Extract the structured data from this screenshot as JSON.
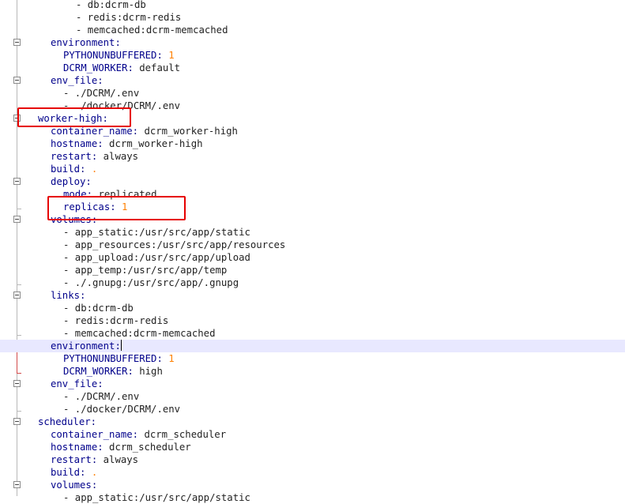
{
  "editor": {
    "current_line_index": 27,
    "lines": [
      {
        "indent": 6,
        "parts": [
          {
            "t": "- db:dcrm-db",
            "c": "str"
          }
        ]
      },
      {
        "indent": 6,
        "parts": [
          {
            "t": "- redis:dcrm-redis",
            "c": "str"
          }
        ]
      },
      {
        "indent": 6,
        "parts": [
          {
            "t": "- memcached:dcrm-memcached",
            "c": "str"
          }
        ]
      },
      {
        "indent": 2,
        "parts": [
          {
            "t": "environment",
            "c": "key"
          },
          {
            "t": ":",
            "c": "punc"
          }
        ]
      },
      {
        "indent": 4,
        "parts": [
          {
            "t": "PYTHONUNBUFFERED",
            "c": "key"
          },
          {
            "t": ": ",
            "c": "punc"
          },
          {
            "t": "1",
            "c": "num"
          }
        ]
      },
      {
        "indent": 4,
        "parts": [
          {
            "t": "DCRM_WORKER",
            "c": "key"
          },
          {
            "t": ": ",
            "c": "punc"
          },
          {
            "t": "default",
            "c": "str"
          }
        ]
      },
      {
        "indent": 2,
        "parts": [
          {
            "t": "env_file",
            "c": "key"
          },
          {
            "t": ":",
            "c": "punc"
          }
        ]
      },
      {
        "indent": 4,
        "parts": [
          {
            "t": "- ./DCRM/.env",
            "c": "str"
          }
        ]
      },
      {
        "indent": 4,
        "parts": [
          {
            "t": "- ./docker/DCRM/.env",
            "c": "str"
          }
        ]
      },
      {
        "indent": 0,
        "parts": [
          {
            "t": "worker-high",
            "c": "key"
          },
          {
            "t": ":",
            "c": "punc"
          }
        ]
      },
      {
        "indent": 2,
        "parts": [
          {
            "t": "container_name",
            "c": "key"
          },
          {
            "t": ": ",
            "c": "punc"
          },
          {
            "t": "dcrm_worker-high",
            "c": "str"
          }
        ]
      },
      {
        "indent": 2,
        "parts": [
          {
            "t": "hostname",
            "c": "key"
          },
          {
            "t": ": ",
            "c": "punc"
          },
          {
            "t": "dcrm_worker-high",
            "c": "str"
          }
        ]
      },
      {
        "indent": 2,
        "parts": [
          {
            "t": "restart",
            "c": "key"
          },
          {
            "t": ": ",
            "c": "punc"
          },
          {
            "t": "always",
            "c": "str"
          }
        ]
      },
      {
        "indent": 2,
        "parts": [
          {
            "t": "build",
            "c": "key"
          },
          {
            "t": ": ",
            "c": "punc"
          },
          {
            "t": ".",
            "c": "num"
          }
        ]
      },
      {
        "indent": 2,
        "parts": [
          {
            "t": "deploy",
            "c": "key"
          },
          {
            "t": ":",
            "c": "punc"
          }
        ]
      },
      {
        "indent": 4,
        "parts": [
          {
            "t": "mode",
            "c": "key"
          },
          {
            "t": ": ",
            "c": "punc"
          },
          {
            "t": "replicated",
            "c": "str"
          }
        ]
      },
      {
        "indent": 4,
        "parts": [
          {
            "t": "replicas",
            "c": "key"
          },
          {
            "t": ": ",
            "c": "punc"
          },
          {
            "t": "1",
            "c": "num"
          }
        ]
      },
      {
        "indent": 2,
        "parts": [
          {
            "t": "volumes",
            "c": "key"
          },
          {
            "t": ":",
            "c": "punc"
          }
        ]
      },
      {
        "indent": 4,
        "parts": [
          {
            "t": "- app_static:/usr/src/app/static",
            "c": "str"
          }
        ]
      },
      {
        "indent": 4,
        "parts": [
          {
            "t": "- app_resources:/usr/src/app/resources",
            "c": "str"
          }
        ]
      },
      {
        "indent": 4,
        "parts": [
          {
            "t": "- app_upload:/usr/src/app/upload",
            "c": "str"
          }
        ]
      },
      {
        "indent": 4,
        "parts": [
          {
            "t": "- app_temp:/usr/src/app/temp",
            "c": "str"
          }
        ]
      },
      {
        "indent": 4,
        "parts": [
          {
            "t": "- ./.gnupg:/usr/src/app/.gnupg",
            "c": "str"
          }
        ]
      },
      {
        "indent": 2,
        "parts": [
          {
            "t": "links",
            "c": "key"
          },
          {
            "t": ":",
            "c": "punc"
          }
        ]
      },
      {
        "indent": 4,
        "parts": [
          {
            "t": "- db:dcrm-db",
            "c": "str"
          }
        ]
      },
      {
        "indent": 4,
        "parts": [
          {
            "t": "- redis:dcrm-redis",
            "c": "str"
          }
        ]
      },
      {
        "indent": 4,
        "parts": [
          {
            "t": "- memcached:dcrm-memcached",
            "c": "str"
          }
        ]
      },
      {
        "indent": 2,
        "parts": [
          {
            "t": "environment",
            "c": "key"
          },
          {
            "t": ":",
            "c": "punc"
          }
        ]
      },
      {
        "indent": 4,
        "parts": [
          {
            "t": "PYTHONUNBUFFERED",
            "c": "key"
          },
          {
            "t": ": ",
            "c": "punc"
          },
          {
            "t": "1",
            "c": "num"
          }
        ]
      },
      {
        "indent": 4,
        "parts": [
          {
            "t": "DCRM_WORKER",
            "c": "key"
          },
          {
            "t": ": ",
            "c": "punc"
          },
          {
            "t": "high",
            "c": "str"
          }
        ]
      },
      {
        "indent": 2,
        "parts": [
          {
            "t": "env_file",
            "c": "key"
          },
          {
            "t": ":",
            "c": "punc"
          }
        ]
      },
      {
        "indent": 4,
        "parts": [
          {
            "t": "- ./DCRM/.env",
            "c": "str"
          }
        ]
      },
      {
        "indent": 4,
        "parts": [
          {
            "t": "- ./docker/DCRM/.env",
            "c": "str"
          }
        ]
      },
      {
        "indent": 0,
        "parts": [
          {
            "t": "scheduler",
            "c": "key"
          },
          {
            "t": ":",
            "c": "punc"
          }
        ]
      },
      {
        "indent": 2,
        "parts": [
          {
            "t": "container_name",
            "c": "key"
          },
          {
            "t": ": ",
            "c": "punc"
          },
          {
            "t": "dcrm_scheduler",
            "c": "str"
          }
        ]
      },
      {
        "indent": 2,
        "parts": [
          {
            "t": "hostname",
            "c": "key"
          },
          {
            "t": ": ",
            "c": "punc"
          },
          {
            "t": "dcrm_scheduler",
            "c": "str"
          }
        ]
      },
      {
        "indent": 2,
        "parts": [
          {
            "t": "restart",
            "c": "key"
          },
          {
            "t": ": ",
            "c": "punc"
          },
          {
            "t": "always",
            "c": "str"
          }
        ]
      },
      {
        "indent": 2,
        "parts": [
          {
            "t": "build",
            "c": "key"
          },
          {
            "t": ": ",
            "c": "punc"
          },
          {
            "t": ".",
            "c": "num"
          }
        ]
      },
      {
        "indent": 2,
        "parts": [
          {
            "t": "volumes",
            "c": "key"
          },
          {
            "t": ":",
            "c": "punc"
          }
        ]
      },
      {
        "indent": 4,
        "parts": [
          {
            "t": "- app_static:/usr/src/app/static",
            "c": "str"
          }
        ]
      }
    ]
  }
}
